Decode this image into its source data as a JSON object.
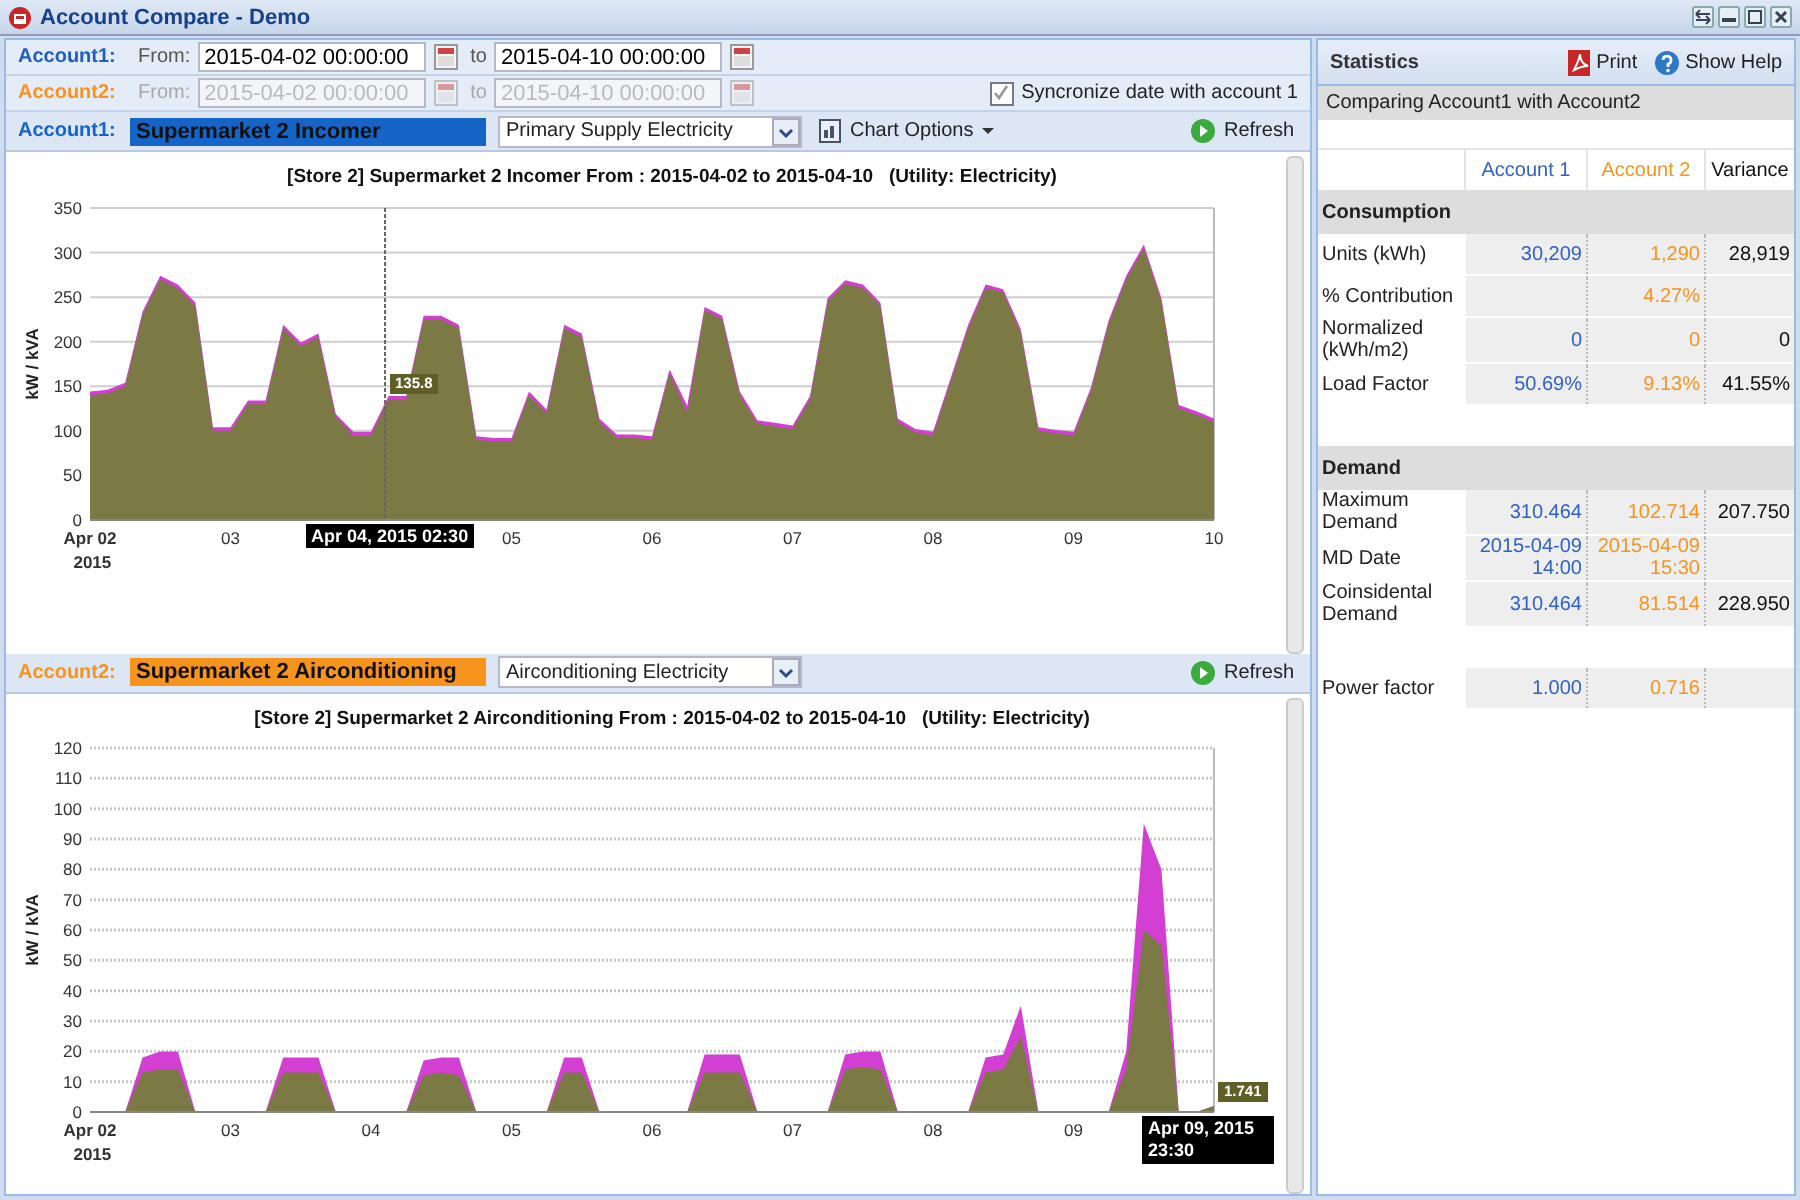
{
  "window": {
    "title": "Account Compare - Demo"
  },
  "date_rows": [
    {
      "label": "Account1:",
      "color": "#1f5fbf",
      "disabled": false,
      "from_label": "From:",
      "from": "2015-04-02 00:00:00",
      "to_label": "to",
      "to": "2015-04-10 00:00:00"
    },
    {
      "label": "Account2:",
      "color": "#f7931e",
      "disabled": true,
      "from_label": "From:",
      "from": "2015-04-02 00:00:00",
      "to_label": "to",
      "to": "2015-04-10 00:00:00",
      "sync": {
        "label": "Syncronize date with account 1",
        "checked": true
      }
    }
  ],
  "charts": [
    {
      "account_label": "Account1:",
      "color": "#1565c8",
      "name": "Supermarket 2 Incomer",
      "utility": "Primary Supply Electricity",
      "chart_options": "Chart Options",
      "refresh": "Refresh",
      "crosshair_time": "Apr 04, 2015 02:30",
      "chart_data": {
        "type": "area",
        "title": "[Store 2] Supermarket 2 Incomer From : 2015-04-02 to 2015-04-10   (Utility: Electricity)",
        "ylabel": "kW / kVA",
        "xlim": [
          2,
          10
        ],
        "ylim": [
          0,
          350
        ],
        "grid": true,
        "xticks": [
          {
            "value": 2,
            "label": "Apr 02 2015"
          },
          {
            "value": 3,
            "label": "03"
          },
          {
            "value": 5,
            "label": "05"
          },
          {
            "value": 6,
            "label": "06"
          },
          {
            "value": 7,
            "label": "07"
          },
          {
            "value": 8,
            "label": "08"
          },
          {
            "value": 9,
            "label": "09"
          },
          {
            "value": 10,
            "label": "10"
          }
        ],
        "yticks": [
          0,
          50,
          100,
          150,
          200,
          250,
          300,
          350
        ],
        "x": [
          2,
          2.125,
          2.25,
          2.375,
          2.5,
          2.625,
          2.75,
          2.875,
          3,
          3.125,
          3.25,
          3.375,
          3.5,
          3.625,
          3.75,
          3.875,
          4,
          4.125,
          4.25,
          4.375,
          4.5,
          4.625,
          4.75,
          4.875,
          5,
          5.125,
          5.25,
          5.375,
          5.5,
          5.625,
          5.75,
          5.875,
          6,
          6.125,
          6.25,
          6.375,
          6.5,
          6.625,
          6.75,
          6.875,
          7,
          7.125,
          7.25,
          7.375,
          7.5,
          7.625,
          7.75,
          7.875,
          8,
          8.125,
          8.25,
          8.375,
          8.5,
          8.625,
          8.75,
          8.875,
          9,
          9.125,
          9.25,
          9.375,
          9.5,
          9.625,
          9.75,
          9.875,
          10
        ],
        "series": [
          {
            "color": "#7b7a45",
            "values": [
              140,
              142,
              150,
              230,
              270,
              260,
              240,
              100,
              100,
              130,
              130,
              215,
              195,
              205,
              115,
              95,
              95,
              135,
              135,
              225,
              225,
              215,
              90,
              88,
              88,
              140,
              120,
              215,
              205,
              110,
              92,
              92,
              90,
              165,
              120,
              235,
              225,
              140,
              108,
              105,
              102,
              135,
              245,
              265,
              260,
              240,
              110,
              98,
              95,
              155,
              215,
              260,
              255,
              210,
              100,
              97,
              95,
              145,
              220,
              270,
              305,
              245,
              125,
              118,
              110
            ]
          },
          {
            "color": "#d23fd2",
            "values": [
              144,
              146,
              154,
              234,
              274,
              264,
              244,
              104,
              104,
              134,
              134,
              219,
              199,
              209,
              119,
              99,
              99,
              139,
              139,
              229,
              229,
              219,
              94,
              92,
              92,
              144,
              124,
              219,
              209,
              114,
              96,
              96,
              94,
              169,
              128,
              239,
              229,
              144,
              112,
              109,
              106,
              139,
              249,
              269,
              264,
              244,
              114,
              102,
              99,
              159,
              219,
              264,
              259,
              214,
              104,
              101,
              99,
              149,
              224,
              274,
              309,
              249,
              129,
              122,
              114
            ]
          }
        ],
        "ref_lines": [
          {
            "axis": "x",
            "value": 4.1
          }
        ],
        "annotations": [
          {
            "x": 4.1,
            "y": 135.8,
            "text": "135.8"
          }
        ]
      }
    },
    {
      "account_label": "Account2:",
      "color": "#f7941d",
      "name": "Supermarket 2 Airconditioning",
      "utility": "Airconditioning Electricity",
      "refresh": "Refresh",
      "crosshair_time": "Apr 09, 2015 23:30",
      "chart_data": {
        "type": "area",
        "title": "[Store 2] Supermarket 2 Airconditioning From : 2015-04-02 to 2015-04-10   (Utility: Electricity)",
        "ylabel": "kW / kVA",
        "xlim": [
          2,
          10
        ],
        "ylim": [
          0,
          120
        ],
        "grid": true,
        "xticks": [
          {
            "value": 2,
            "label": "Apr 02 2015"
          },
          {
            "value": 3,
            "label": "03"
          },
          {
            "value": 4,
            "label": "04"
          },
          {
            "value": 5,
            "label": "05"
          },
          {
            "value": 6,
            "label": "06"
          },
          {
            "value": 7,
            "label": "07"
          },
          {
            "value": 8,
            "label": "08"
          },
          {
            "value": 9,
            "label": "09"
          }
        ],
        "yticks": [
          0,
          10,
          20,
          30,
          40,
          50,
          60,
          70,
          80,
          90,
          100,
          110,
          120
        ],
        "x": [
          2,
          2.125,
          2.25,
          2.375,
          2.5,
          2.625,
          2.75,
          2.875,
          3,
          3.125,
          3.25,
          3.375,
          3.5,
          3.625,
          3.75,
          3.875,
          4,
          4.125,
          4.25,
          4.375,
          4.5,
          4.625,
          4.75,
          4.875,
          5,
          5.125,
          5.25,
          5.375,
          5.5,
          5.625,
          5.75,
          5.875,
          6,
          6.125,
          6.25,
          6.375,
          6.5,
          6.625,
          6.75,
          6.875,
          7,
          7.125,
          7.25,
          7.375,
          7.5,
          7.625,
          7.75,
          7.875,
          8,
          8.125,
          8.25,
          8.375,
          8.5,
          8.625,
          8.75,
          8.875,
          9,
          9.125,
          9.25,
          9.375,
          9.5,
          9.625,
          9.75,
          9.875,
          10
        ],
        "series": [
          {
            "color": "#7b7a45",
            "values": [
              0,
              0,
              0,
              13,
              14,
              14,
              0,
              0,
              0,
              0,
              0,
              13,
              13,
              13,
              0,
              0,
              0,
              0,
              0,
              12,
              13,
              12,
              0,
              0,
              0,
              0,
              0,
              13,
              13,
              0,
              0,
              0,
              0,
              0,
              0,
              13,
              13,
              13,
              0,
              0,
              0,
              0,
              0,
              14,
              15,
              14,
              0,
              0,
              0,
              0,
              0,
              13,
              14,
              25,
              0,
              0,
              0,
              0,
              0,
              14,
              60,
              55,
              0,
              0,
              2
            ]
          },
          {
            "color": "#d23fd2",
            "values": [
              0,
              0,
              0,
              18,
              20,
              20,
              0,
              0,
              0,
              0,
              0,
              18,
              18,
              18,
              0,
              0,
              0,
              0,
              0,
              17,
              18,
              18,
              0,
              0,
              0,
              0,
              0,
              18,
              18,
              0,
              0,
              0,
              0,
              0,
              0,
              19,
              19,
              19,
              0,
              0,
              0,
              0,
              0,
              19,
              20,
              20,
              0,
              0,
              0,
              0,
              0,
              18,
              19,
              35,
              0,
              0,
              0,
              0,
              0,
              20,
              95,
              80,
              0,
              0,
              2
            ]
          }
        ],
        "annotations": [
          {
            "x": 10,
            "y": 1.741,
            "text": "1.741"
          }
        ]
      }
    }
  ],
  "statistics": {
    "title": "Statistics",
    "print": "Print",
    "help": "Show Help",
    "comparing": "Comparing Account1 with Account2",
    "columns": [
      {
        "label": "Account 1",
        "color": "#2f62c8"
      },
      {
        "label": "Account 2",
        "color": "#f7931e"
      },
      {
        "label": "Variance",
        "color": "#111111"
      }
    ],
    "sections": [
      {
        "title": "Consumption",
        "rows": [
          {
            "label": "Units (kWh)",
            "values": {
              "account_1": "30,209",
              "account_2": "1,290",
              "variance": "28,919"
            }
          },
          {
            "label": "% Contribution",
            "values": {
              "account_2": "4.27%"
            }
          },
          {
            "label": "Normalized (kWh/m2)",
            "values": {
              "account_1": "0",
              "account_2": "0",
              "variance": "0"
            }
          },
          {
            "label": "Load Factor",
            "values": {
              "account_1": "50.69%",
              "account_2": "9.13%",
              "variance": "41.55%"
            }
          }
        ]
      },
      {
        "title": "Demand",
        "rows": [
          {
            "label": "Maximum Demand",
            "values": {
              "account_1": "310.464",
              "account_2": "102.714",
              "variance": "207.750"
            }
          },
          {
            "label": "MD Date",
            "values": {
              "account_1": "2015-04-09 14:00",
              "account_2": "2015-04-09 15:30"
            }
          },
          {
            "label": "Coinsidental Demand",
            "values": {
              "account_1": "310.464",
              "account_2": "81.514",
              "variance": "228.950"
            }
          }
        ]
      },
      {
        "rows": [
          {
            "label": "Power factor",
            "values": {
              "account_1": "1.000",
              "account_2": "0.716"
            }
          }
        ]
      }
    ]
  }
}
